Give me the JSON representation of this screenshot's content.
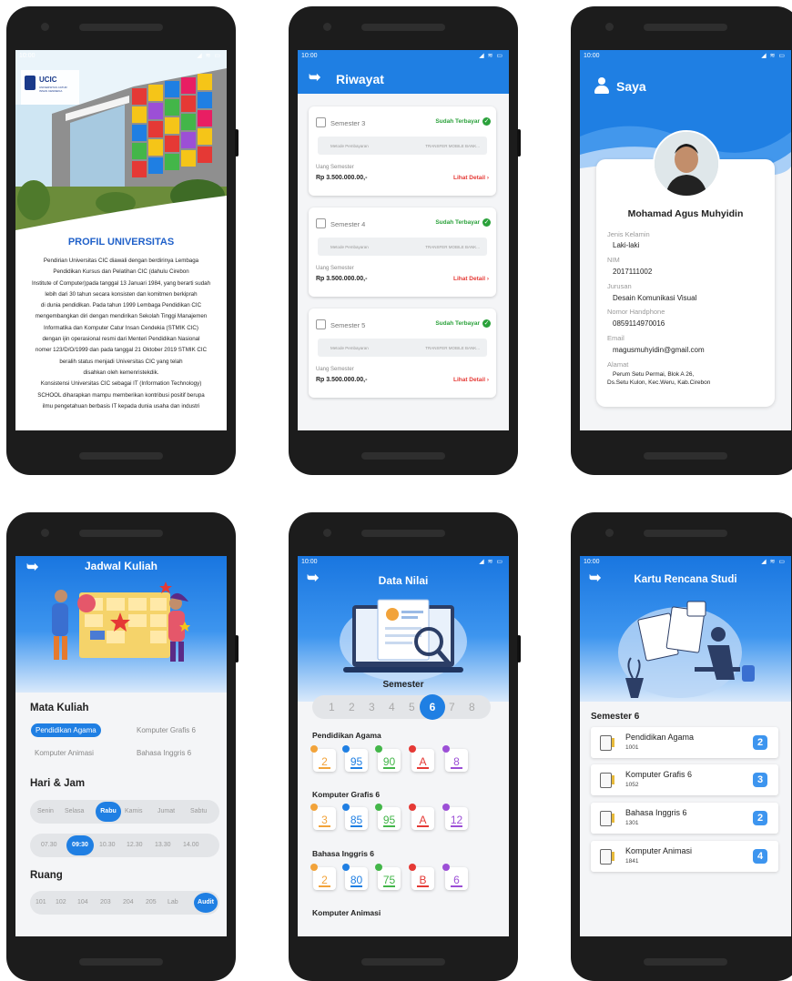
{
  "status_time": "10:00",
  "profile": {
    "logo_text": "UCIC",
    "logo_sub": "UNIVERSITAS CATUR INSAN CENDEKIA",
    "title": "PROFIL UNIVERSITAS",
    "lines": [
      "Pendirian Universitas CIC diawali dengan berdirinya Lembaga",
      "Pendidikan Kursus dan Pelatihan CIC (dahulu Cirebon",
      "Institute of Computer)pada tanggal 13 Januari 1984, yang berarti sudah",
      "lebih dari 30 tahun secara konsisten dan komitmen berkiprah",
      "di dunia pendidikan. Pada tahun 1999 Lembaga Pendidikan CIC",
      "mengembangkan diri dengan mendirikan Sekolah Tinggi Manajemen",
      "Informatika dan Komputer Catur Insan Cendekia (STMIK CIC)",
      "dengan ijin operasional resmi dari Menteri Pendidikan Nasional",
      "nomer 123/D/O/1999 dan pada tanggal 21 Oktober 2019 STMIK CIC",
      "beralih status menjadi Universitas CIC yang telah",
      "disahkan oleh kemenristekdik.",
      "Konsistensi Universitas CIC sebagai IT (Information Technology)",
      "SCHOOL diharapkan mampu memberikan kontribusi positif berupa",
      "ilmu pengetahuan berbasis IT kepada dunia usaha dan industri"
    ]
  },
  "riwayat": {
    "title": "Riwayat",
    "cards": [
      {
        "semester": "Semester 3",
        "status": "Sudah Terbayar",
        "method_label": "Metode Pembayaran",
        "method_value": "TRANSFER MOBILE BANK...",
        "fee_label": "Uang Semester",
        "amount": "Rp 3.500.000.00,-",
        "detail": "Lihat Detail"
      },
      {
        "semester": "Semester 4",
        "status": "Sudah Terbayar",
        "method_label": "Metode Pembayaran",
        "method_value": "TRANSFER MOBILE BANK...",
        "fee_label": "Uang Semester",
        "amount": "Rp 3.500.000.00,-",
        "detail": "Lihat Detail"
      },
      {
        "semester": "Semester 5",
        "status": "Sudah Terbayar",
        "method_label": "Metode Pembayaran",
        "method_value": "TRANSFER MOBILE BANK...",
        "fee_label": "Uang Semester",
        "amount": "Rp 3.500.000.00,-",
        "detail": "Lihat Detail"
      }
    ]
  },
  "saya": {
    "title": "Saya",
    "name": "Mohamad Agus Muhyidin",
    "fields": [
      {
        "label": "Jenis Kelamin",
        "value": "Laki-laki"
      },
      {
        "label": "NIM",
        "value": "2017111002"
      },
      {
        "label": "Jurusan",
        "value": "Desain Komunikasi Visual"
      },
      {
        "label": "Nomor Handphone",
        "value": "0859114970016"
      },
      {
        "label": "Email",
        "value": "magusmuhyidin@gmail.com"
      },
      {
        "label": "Alamat",
        "value": "Perum Setu Permai, Blok A 26,",
        "value2": "Ds.Setu Kulon, Kec.Weru, Kab.Cirebon"
      }
    ]
  },
  "jadwal": {
    "title": "Jadwal Kuliah",
    "mk_title": "Mata Kuliah",
    "courses": [
      "Pendidikan Agama",
      "Komputer Grafis 6",
      "Komputer Animasi",
      "Bahasa Inggris 6"
    ],
    "hari_title": "Hari & Jam",
    "days": [
      "Senin",
      "Selasa",
      "Rabu",
      "Kamis",
      "Jumat",
      "Sabtu"
    ],
    "times": [
      "07.30",
      "09:30",
      "10.30",
      "12.30",
      "13.30",
      "14.00"
    ],
    "ruang_title": "Ruang",
    "rooms": [
      "101",
      "102",
      "104",
      "203",
      "204",
      "205",
      "Lab",
      "Audit"
    ]
  },
  "nilai": {
    "title": "Data Nilai",
    "semester_label": "Semester",
    "semesters": [
      "1",
      "2",
      "3",
      "4",
      "5",
      "6",
      "7",
      "8"
    ],
    "selected_semester": "6",
    "subjects": [
      {
        "name": "Pendidikan Agama",
        "grades": [
          "2",
          "95",
          "90",
          "A",
          "8"
        ]
      },
      {
        "name": "Komputer Grafis 6",
        "grades": [
          "3",
          "85",
          "95",
          "A",
          "12"
        ]
      },
      {
        "name": "Bahasa Inggris 6",
        "grades": [
          "2",
          "80",
          "75",
          "B",
          "6"
        ]
      },
      {
        "name": "Komputer Animasi",
        "grades": []
      }
    ],
    "grade_colors": [
      "#f2a33a",
      "#1f7fe3",
      "#43b649",
      "#e53935",
      "#9c4fd6"
    ]
  },
  "krs": {
    "title": "Kartu Rencana Studi",
    "semester": "Semester 6",
    "rows": [
      {
        "name": "Pendidikan Agama",
        "code": "1001",
        "sks": "2"
      },
      {
        "name": "Komputer Grafis 6",
        "code": "1052",
        "sks": "3"
      },
      {
        "name": "Bahasa Inggris 6",
        "code": "1301",
        "sks": "2"
      },
      {
        "name": "Komputer Animasi",
        "code": "1841",
        "sks": "4"
      }
    ]
  }
}
